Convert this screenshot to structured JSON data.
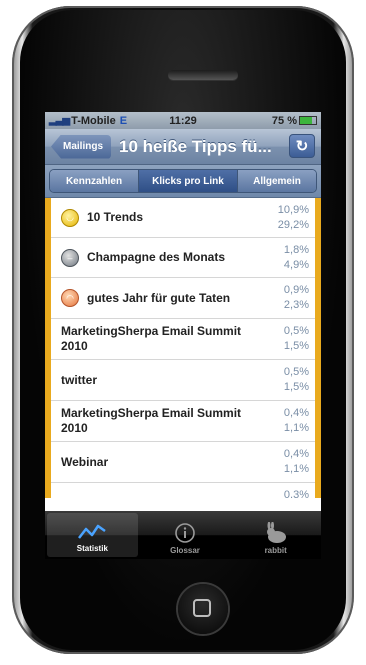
{
  "status_bar": {
    "carrier": "T-Mobile",
    "network": "E",
    "time": "11:29",
    "battery": "75 %"
  },
  "nav": {
    "back_label": "Mailings",
    "title": "10 heiße Tipps fü...",
    "refresh_icon": "refresh-icon"
  },
  "segments": {
    "items": [
      "Kennzahlen",
      "Klicks pro Link",
      "Allgemein"
    ],
    "selected_index": 1
  },
  "list": {
    "accent_color": "#e9aa1e",
    "rows": [
      {
        "label": "10 Trends",
        "v1": "10,9%",
        "v2": "29,2%",
        "icon": "yellow"
      },
      {
        "label": "Champagne des Monats",
        "v1": "1,8%",
        "v2": "4,9%",
        "icon": "gray"
      },
      {
        "label": "gutes Jahr für gute Taten",
        "v1": "0,9%",
        "v2": "2,3%",
        "icon": "orange"
      },
      {
        "label": "MarketingSherpa  Email Summit 2010",
        "v1": "0,5%",
        "v2": "1,5%",
        "icon": ""
      },
      {
        "label": "twitter",
        "v1": "0,5%",
        "v2": "1,5%",
        "icon": ""
      },
      {
        "label": "MarketingSherpa  Email Summit 2010",
        "v1": "0,4%",
        "v2": "1,1%",
        "icon": ""
      },
      {
        "label": "Webinar",
        "v1": "0,4%",
        "v2": "1,1%",
        "icon": ""
      },
      {
        "label": "",
        "v1": "0,3%",
        "v2": "",
        "icon": ""
      }
    ]
  },
  "tabs": [
    {
      "label": "Statistik",
      "icon": "chart-icon",
      "active": true
    },
    {
      "label": "Glossar",
      "icon": "info-icon",
      "active": false
    },
    {
      "label": "rabbit",
      "icon": "rabbit-icon",
      "active": false
    }
  ]
}
